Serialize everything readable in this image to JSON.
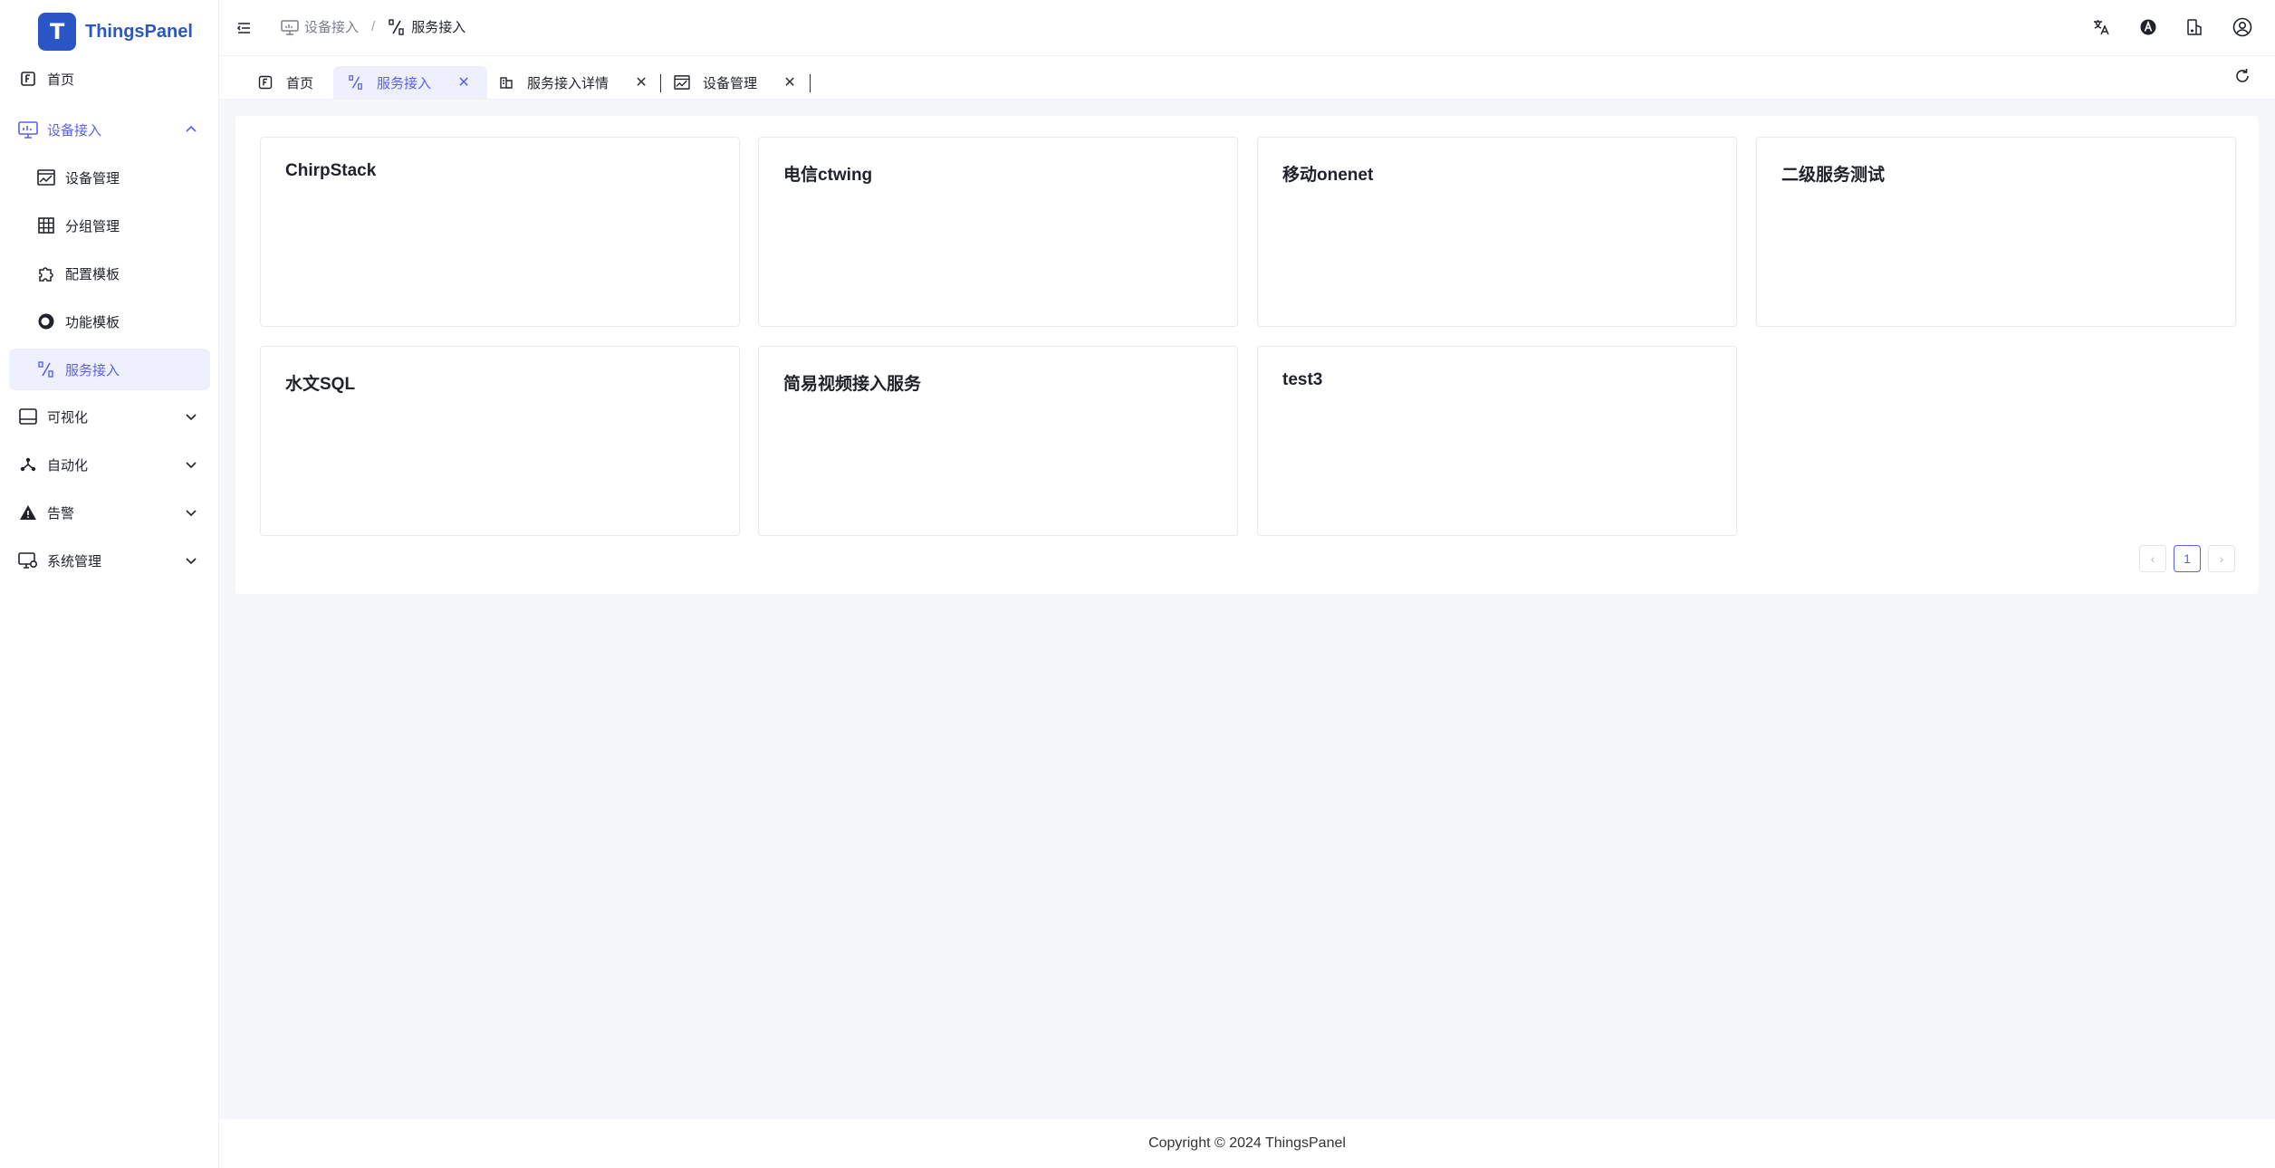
{
  "app": {
    "logo_letter": "T",
    "name": "ThingsPanel"
  },
  "sidebar": {
    "items": [
      {
        "label": "首页",
        "icon": "home-icon"
      },
      {
        "label": "设备接入",
        "icon": "monitor-icon",
        "expanded": true
      },
      {
        "label": "设备管理",
        "icon": "chart-window-icon"
      },
      {
        "label": "分组管理",
        "icon": "grid-icon"
      },
      {
        "label": "配置模板",
        "icon": "puzzle-icon"
      },
      {
        "label": "功能模板",
        "icon": "circle-icon"
      },
      {
        "label": "服务接入",
        "icon": "percent-icon",
        "active": true
      },
      {
        "label": "可视化",
        "icon": "screen-icon"
      },
      {
        "label": "自动化",
        "icon": "network-icon"
      },
      {
        "label": "告警",
        "icon": "warning-icon"
      },
      {
        "label": "系统管理",
        "icon": "settings-monitor-icon"
      }
    ]
  },
  "header": {
    "breadcrumb": [
      {
        "label": "设备接入",
        "icon": "monitor-icon"
      },
      {
        "label": "服务接入",
        "icon": "percent-icon"
      }
    ],
    "breadcrumb_separator": "/",
    "icons": [
      "translate-icon",
      "theme-icon",
      "theme-config-icon",
      "user-icon"
    ]
  },
  "tabs": [
    {
      "label": "首页",
      "icon": "home-icon",
      "closable": false
    },
    {
      "label": "服务接入",
      "icon": "percent-icon",
      "closable": true,
      "active": true
    },
    {
      "label": "服务接入详情",
      "icon": "detail-icon",
      "closable": true
    },
    {
      "label": "设备管理",
      "icon": "chart-window-icon",
      "closable": true
    }
  ],
  "tab_close_glyph": "✕",
  "services": [
    {
      "name": "ChirpStack"
    },
    {
      "name": "电信ctwing"
    },
    {
      "name": "移动onenet"
    },
    {
      "name": "二级服务测试"
    },
    {
      "name": "水文SQL"
    },
    {
      "name": "简易视频接入服务"
    },
    {
      "name": "test3"
    }
  ],
  "pagination": {
    "prev": "‹",
    "current_page": "1",
    "next": "›"
  },
  "footer": {
    "copyright": "Copyright © 2024 ThingsPanel"
  },
  "colors": {
    "accent": "#5b5ff0",
    "brand": "#2b57c6",
    "active_bg": "#eef0fe",
    "page_bg": "#f5f7fb"
  }
}
